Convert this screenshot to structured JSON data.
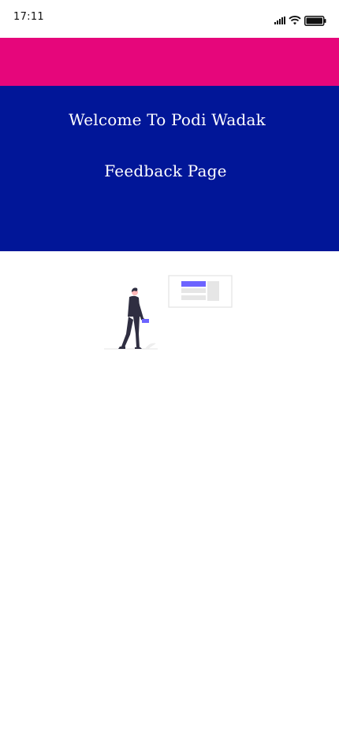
{
  "status_bar": {
    "time": "17:11",
    "icons": [
      "signal-icon",
      "wifi-icon",
      "battery-icon"
    ]
  },
  "colors": {
    "accent_bar": "#e6067b",
    "header_background": "#011698",
    "illustration_accent": "#6c63ff"
  },
  "header": {
    "title": "Welcome To Podi Wadak",
    "subtitle": "Feedback Page"
  },
  "illustration": {
    "name": "person-with-form-illustration"
  }
}
